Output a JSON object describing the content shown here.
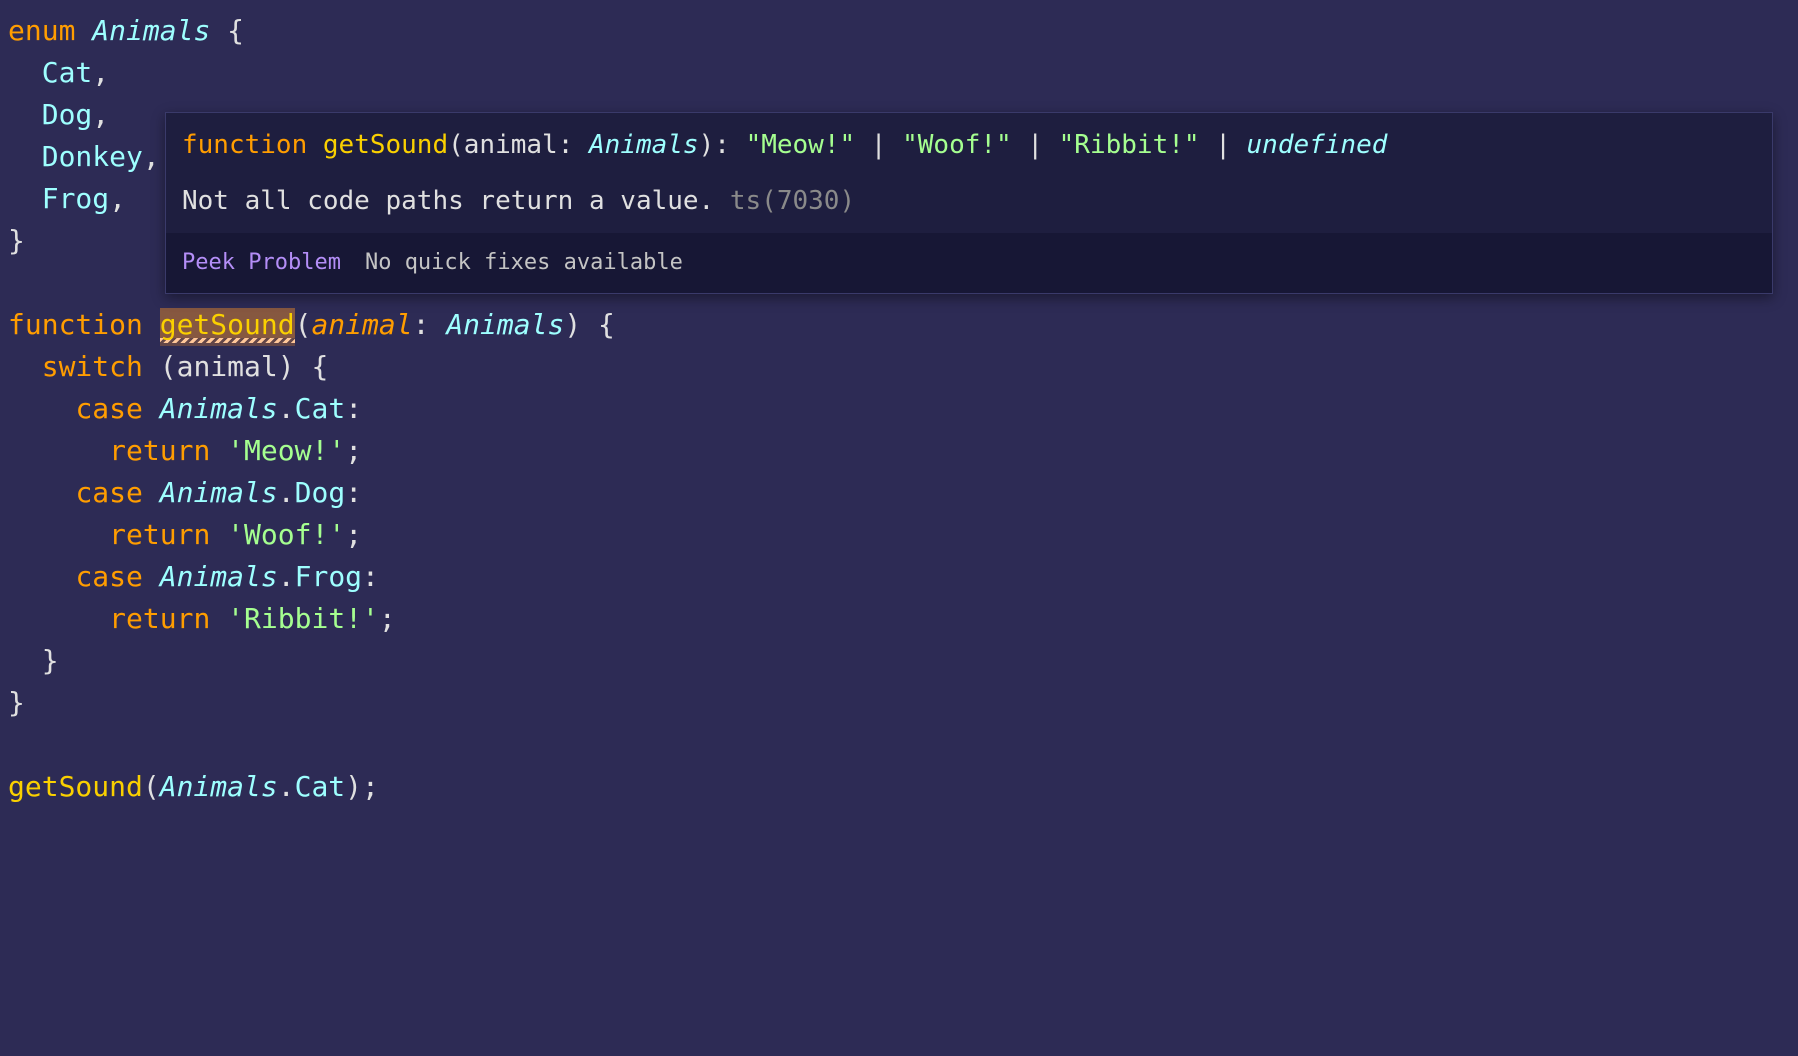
{
  "code": {
    "l1": {
      "enum_kw": "enum",
      "name": "Animals",
      "brace": " {"
    },
    "l2": {
      "indent": "  ",
      "val": "Cat",
      "comma": ","
    },
    "l3": {
      "indent": "  ",
      "val": "Dog",
      "comma": ","
    },
    "l4": {
      "indent": "  ",
      "val": "Donkey",
      "comma": ","
    },
    "l5": {
      "indent": "  ",
      "val": "Frog",
      "comma": ","
    },
    "l6": {
      "brace": "}"
    },
    "l7": "",
    "l8": {
      "fn_kw": "function",
      "sp": " ",
      "name": "getSound",
      "open": "(",
      "param": "animal",
      "colon": ": ",
      "param_type": "Animals",
      "close": ")",
      "brace": " {"
    },
    "l9": {
      "indent": "  ",
      "switch_kw": "switch",
      "sp": " (",
      "expr": "animal",
      "close": ") {"
    },
    "l10": {
      "indent": "    ",
      "case_kw": "case",
      "sp": " ",
      "obj": "Animals",
      "dot": ".",
      "prop": "Cat",
      "colon": ":"
    },
    "l11": {
      "indent": "      ",
      "ret_kw": "return",
      "sp": " ",
      "str": "'Meow!'",
      "semi": ";"
    },
    "l12": {
      "indent": "    ",
      "case_kw": "case",
      "sp": " ",
      "obj": "Animals",
      "dot": ".",
      "prop": "Dog",
      "colon": ":"
    },
    "l13": {
      "indent": "      ",
      "ret_kw": "return",
      "sp": " ",
      "str": "'Woof!'",
      "semi": ";"
    },
    "l14": {
      "indent": "    ",
      "case_kw": "case",
      "sp": " ",
      "obj": "Animals",
      "dot": ".",
      "prop": "Frog",
      "colon": ":"
    },
    "l15": {
      "indent": "      ",
      "ret_kw": "return",
      "sp": " ",
      "str": "'Ribbit!'",
      "semi": ";"
    },
    "l16": {
      "indent": "  ",
      "brace": "}"
    },
    "l17": {
      "brace": "}"
    },
    "l18": "",
    "l19": {
      "fn": "getSound",
      "open": "(",
      "obj": "Animals",
      "dot": ".",
      "prop": "Cat",
      "close": ");"
    }
  },
  "hover": {
    "sig": {
      "fn_kw": "function",
      "fn_name": "getSound",
      "open": "(",
      "param": "animal",
      "colon": ": ",
      "param_type": "Animals",
      "close": "): ",
      "r1": "\"Meow!\"",
      "pipe1": " | ",
      "r2": "\"Woof!\"",
      "pipe2": " | ",
      "r3": "\"Ribbit!\"",
      "pipe3": " | ",
      "r4": "undefined"
    },
    "msg": "Not all code paths return a value. ",
    "errcode": "ts(7030)",
    "peek": "Peek Problem",
    "nofix": "No quick fixes available"
  }
}
